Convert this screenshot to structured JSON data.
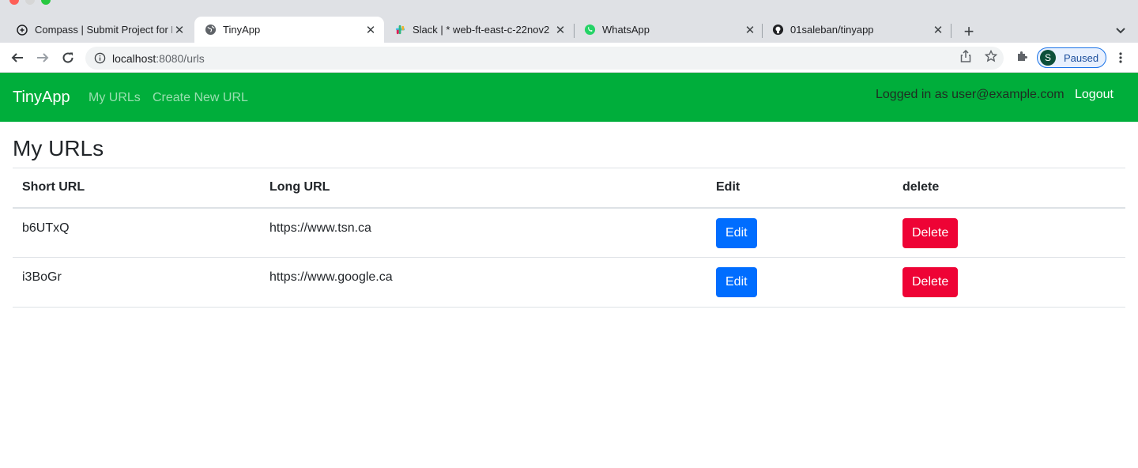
{
  "browser": {
    "tabs": [
      {
        "title": "Compass | Submit Project for E",
        "icon": "compass-icon"
      },
      {
        "title": "TinyApp",
        "icon": "globe-icon"
      },
      {
        "title": "Slack | * web-ft-east-c-22nov2",
        "icon": "slack-icon"
      },
      {
        "title": "WhatsApp",
        "icon": "whatsapp-icon"
      },
      {
        "title": "01saleban/tinyapp",
        "icon": "github-icon"
      }
    ],
    "address": {
      "host": "localhost",
      "path": ":8080/urls"
    },
    "profile": {
      "initial": "S",
      "status": "Paused"
    }
  },
  "navbar": {
    "brand": "TinyApp",
    "links": [
      "My URLs",
      "Create New URL"
    ],
    "logged_in_text": "Logged in as user@example.com",
    "logout": "Logout"
  },
  "main": {
    "title": "My URLs",
    "columns": [
      "Short URL",
      "Long URL",
      "Edit",
      "delete"
    ],
    "rows": [
      {
        "short": "b6UTxQ",
        "long": "https://www.tsn.ca",
        "edit": "Edit",
        "delete": "Delete"
      },
      {
        "short": "i3BoGr",
        "long": "https://www.google.ca",
        "edit": "Edit",
        "delete": "Delete"
      }
    ]
  },
  "colors": {
    "navbar": "#00ae3b",
    "edit_button": "#006dff",
    "delete_button": "#ee0335"
  }
}
